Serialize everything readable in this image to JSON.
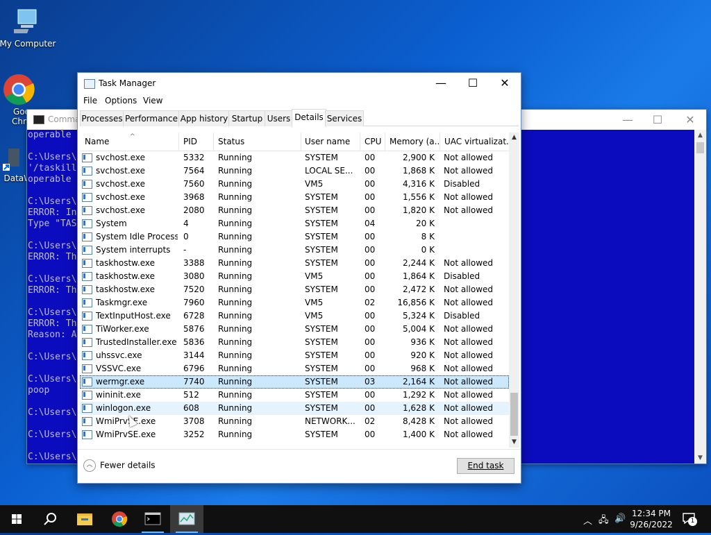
{
  "desktop": {
    "icons": [
      {
        "label": "My Computer"
      },
      {
        "label": "Goo Chro"
      },
      {
        "label": "DataW"
      }
    ]
  },
  "console": {
    "title": "Comma",
    "lines": [
      "operable",
      "",
      "C:\\Users\\",
      "'/taskill",
      "operable",
      "",
      "C:\\Users\\",
      "ERROR: In",
      "Type \"TAS",
      "",
      "C:\\Users\\",
      "ERROR: Th",
      "",
      "C:\\Users\\",
      "ERROR: Th",
      "",
      "C:\\Users\\",
      "ERROR: Th",
      "Reason: A",
      "",
      "C:\\Users\\",
      "",
      "C:\\Users\\",
      "poop",
      "",
      "C:\\Users\\",
      "",
      "C:\\Users\\",
      "",
      "C:\\Users\\"
    ],
    "min": "—",
    "max": "☐",
    "close": "✕"
  },
  "taskmgr": {
    "title": "Task Manager",
    "min": "—",
    "max": "☐",
    "close": "✕",
    "menu": [
      "File",
      "Options",
      "View"
    ],
    "tabs": [
      "Processes",
      "Performance",
      "App history",
      "Startup",
      "Users",
      "Details",
      "Services"
    ],
    "active_tab": "Details",
    "columns": [
      "Name",
      "PID",
      "Status",
      "User name",
      "CPU",
      "Memory (a...",
      "UAC virtualizat..."
    ],
    "rows": [
      {
        "name": "svchost.exe",
        "pid": "5332",
        "status": "Running",
        "user": "SYSTEM",
        "cpu": "00",
        "mem": "2,900 K",
        "uac": "Not allowed"
      },
      {
        "name": "svchost.exe",
        "pid": "7564",
        "status": "Running",
        "user": "LOCAL SE...",
        "cpu": "00",
        "mem": "1,868 K",
        "uac": "Not allowed"
      },
      {
        "name": "svchost.exe",
        "pid": "7560",
        "status": "Running",
        "user": "VM5",
        "cpu": "00",
        "mem": "4,316 K",
        "uac": "Disabled"
      },
      {
        "name": "svchost.exe",
        "pid": "3968",
        "status": "Running",
        "user": "SYSTEM",
        "cpu": "00",
        "mem": "1,556 K",
        "uac": "Not allowed"
      },
      {
        "name": "svchost.exe",
        "pid": "2080",
        "status": "Running",
        "user": "SYSTEM",
        "cpu": "00",
        "mem": "1,820 K",
        "uac": "Not allowed"
      },
      {
        "name": "System",
        "pid": "4",
        "status": "Running",
        "user": "SYSTEM",
        "cpu": "04",
        "mem": "20 K",
        "uac": ""
      },
      {
        "name": "System Idle Process",
        "pid": "0",
        "status": "Running",
        "user": "SYSTEM",
        "cpu": "00",
        "mem": "8 K",
        "uac": ""
      },
      {
        "name": "System interrupts",
        "pid": "-",
        "status": "Running",
        "user": "SYSTEM",
        "cpu": "00",
        "mem": "0 K",
        "uac": ""
      },
      {
        "name": "taskhostw.exe",
        "pid": "3388",
        "status": "Running",
        "user": "SYSTEM",
        "cpu": "00",
        "mem": "2,244 K",
        "uac": "Not allowed"
      },
      {
        "name": "taskhostw.exe",
        "pid": "3080",
        "status": "Running",
        "user": "VM5",
        "cpu": "00",
        "mem": "1,864 K",
        "uac": "Disabled"
      },
      {
        "name": "taskhostw.exe",
        "pid": "7520",
        "status": "Running",
        "user": "SYSTEM",
        "cpu": "00",
        "mem": "2,472 K",
        "uac": "Not allowed"
      },
      {
        "name": "Taskmgr.exe",
        "pid": "7960",
        "status": "Running",
        "user": "VM5",
        "cpu": "02",
        "mem": "16,856 K",
        "uac": "Not allowed"
      },
      {
        "name": "TextInputHost.exe",
        "pid": "6728",
        "status": "Running",
        "user": "VM5",
        "cpu": "00",
        "mem": "5,324 K",
        "uac": "Disabled"
      },
      {
        "name": "TiWorker.exe",
        "pid": "5876",
        "status": "Running",
        "user": "SYSTEM",
        "cpu": "00",
        "mem": "5,004 K",
        "uac": "Not allowed"
      },
      {
        "name": "TrustedInstaller.exe",
        "pid": "5836",
        "status": "Running",
        "user": "SYSTEM",
        "cpu": "00",
        "mem": "936 K",
        "uac": "Not allowed"
      },
      {
        "name": "uhssvc.exe",
        "pid": "3144",
        "status": "Running",
        "user": "SYSTEM",
        "cpu": "00",
        "mem": "920 K",
        "uac": "Not allowed"
      },
      {
        "name": "VSSVC.exe",
        "pid": "6796",
        "status": "Running",
        "user": "SYSTEM",
        "cpu": "00",
        "mem": "968 K",
        "uac": "Not allowed"
      },
      {
        "name": "wermgr.exe",
        "pid": "7740",
        "status": "Running",
        "user": "SYSTEM",
        "cpu": "03",
        "mem": "2,164 K",
        "uac": "Not allowed",
        "selected": true
      },
      {
        "name": "wininit.exe",
        "pid": "512",
        "status": "Running",
        "user": "SYSTEM",
        "cpu": "00",
        "mem": "1,292 K",
        "uac": "Not allowed"
      },
      {
        "name": "winlogon.exe",
        "pid": "608",
        "status": "Running",
        "user": "SYSTEM",
        "cpu": "00",
        "mem": "1,628 K",
        "uac": "Not allowed",
        "hover": true
      },
      {
        "name": "WmiPrvSE.exe",
        "pid": "3708",
        "status": "Running",
        "user": "NETWORK...",
        "cpu": "02",
        "mem": "8,428 K",
        "uac": "Not allowed"
      },
      {
        "name": "WmiPrvSE.exe",
        "pid": "3252",
        "status": "Running",
        "user": "SYSTEM",
        "cpu": "00",
        "mem": "1,400 K",
        "uac": "Not allowed"
      }
    ],
    "fewer_details": "Fewer details",
    "end_task": "End task"
  },
  "taskbar": {
    "apps": [
      "start-icon",
      "search-icon",
      "file-explorer-icon",
      "chrome-icon",
      "command-prompt-icon",
      "task-manager-icon"
    ],
    "time": "12:34 PM",
    "date": "9/26/2022",
    "notification_count": "1"
  },
  "colors": {
    "selected_row": "#cce8ff",
    "console_bg": "#0c0cbf",
    "taskbar": "#101010"
  }
}
